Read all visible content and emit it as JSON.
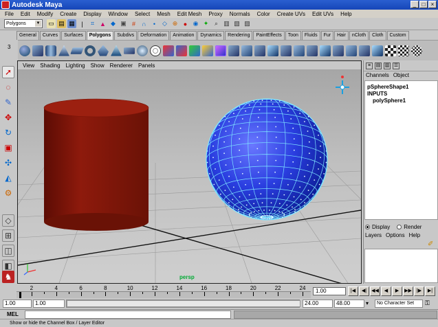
{
  "window": {
    "title": "Autodesk Maya"
  },
  "menus": [
    "File",
    "Edit",
    "Modify",
    "Create",
    "Display",
    "Window",
    "Select",
    "Mesh",
    "Edit Mesh",
    "Proxy",
    "Normals",
    "Color",
    "Create UVs",
    "Edit UVs",
    "Help"
  ],
  "status_line": {
    "mode": "Polygons"
  },
  "shelf": {
    "tabs": [
      "General",
      "Curves",
      "Surfaces",
      "Polygons",
      "Subdivs",
      "Deformation",
      "Animation",
      "Dynamics",
      "Rendering",
      "PaintEffects",
      "Toon",
      "Fluids",
      "Fur",
      "Hair",
      "nCloth",
      "Cloth",
      "Custom"
    ],
    "active_tab": "Polygons",
    "row_number": "3"
  },
  "viewport": {
    "menus": [
      "View",
      "Shading",
      "Lighting",
      "Show",
      "Renderer",
      "Panels"
    ],
    "camera": "persp",
    "colors": {
      "cylinder": "#8e1a0c",
      "sphere": "#2a3ee0",
      "selection": "#7fe6ff"
    }
  },
  "channel_box": {
    "menus": [
      "Channels",
      "Object"
    ],
    "shape": "pSphereShape1",
    "inputs_header": "INPUTS",
    "input_node": "polySphere1",
    "display_radio": "Display",
    "render_radio": "Render",
    "layer_menus": [
      "Layers",
      "Options",
      "Help"
    ]
  },
  "time_slider": {
    "ticks": [
      "2",
      "4",
      "6",
      "8",
      "10",
      "12",
      "14",
      "16",
      "18",
      "20",
      "22",
      "24"
    ],
    "current_frame": "1.00",
    "min_frame": 1,
    "max_frame": 24
  },
  "range_slider": {
    "start": "1.00",
    "playback_start": "1.00",
    "playback_end": "24.00",
    "end": "48.00",
    "character_set": "No Character Set"
  },
  "command_line": {
    "label": "MEL"
  },
  "help_line": {
    "text": "Show or hide the Channel Box / Layer Editor"
  }
}
